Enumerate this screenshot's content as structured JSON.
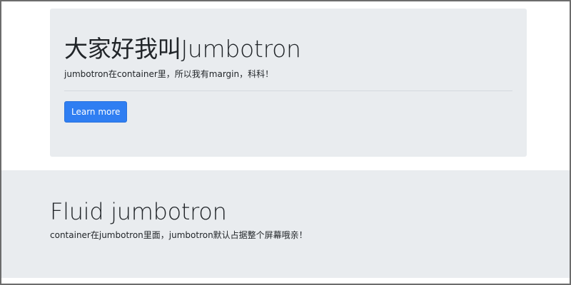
{
  "jumbotron": {
    "title": "大家好我叫Jumbotron",
    "lead": "jumbotron在container里，所以我有margin，科科！",
    "button_label": "Learn more"
  },
  "fluid_jumbotron": {
    "title": "Fluid jumbotron",
    "lead": "container在jumbotron里面，jumbotron默认占据整个屏幕哦亲！"
  },
  "colors": {
    "jumbotron_bg": "#e9ecef",
    "button_bg": "#2f7ef2",
    "text": "#212529"
  }
}
